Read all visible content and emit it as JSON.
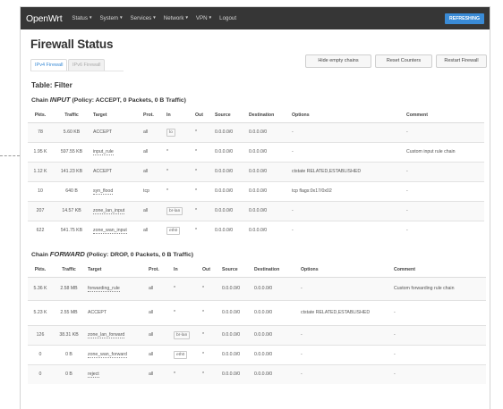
{
  "navbar": {
    "brand": "OpenWrt",
    "menus": [
      "Status",
      "System",
      "Services",
      "Network",
      "VPN"
    ],
    "logout": "Logout",
    "refresh_badge": "REFRESHING"
  },
  "page": {
    "title": "Firewall Status",
    "tabs": [
      {
        "label": "IPv4 Firewall",
        "active": true
      },
      {
        "label": "IPv6 Firewall",
        "active": false
      }
    ],
    "buttons": {
      "hide_empty": "Hide empty chains",
      "reset_counters": "Reset Counters",
      "restart_firewall": "Restart Firewall"
    },
    "table_title": "Table: Filter"
  },
  "input_chain": {
    "label": "Chain",
    "name": "INPUT",
    "policy_text": "(Policy: ACCEPT, 0 Packets, 0 B Traffic)",
    "headers": [
      "Pkts.",
      "Traffic",
      "Target",
      "Prot.",
      "In",
      "Out",
      "Source",
      "Destination",
      "Options",
      "Comment"
    ],
    "rows": [
      {
        "pkts": "78",
        "traffic": "5.60 KB",
        "target": "ACCEPT",
        "target_link": false,
        "prot": "all",
        "in": "lo",
        "in_box": true,
        "out": "*",
        "source": "0.0.0.0/0",
        "destination": "0.0.0.0/0",
        "options": "-",
        "comment": "-"
      },
      {
        "pkts": "1.95 K",
        "traffic": "597.55 KB",
        "target": "input_rule",
        "target_link": true,
        "prot": "all",
        "in": "*",
        "in_box": false,
        "out": "*",
        "source": "0.0.0.0/0",
        "destination": "0.0.0.0/0",
        "options": "-",
        "comment": "Custom input rule chain"
      },
      {
        "pkts": "1.12 K",
        "traffic": "141.23 KB",
        "target": "ACCEPT",
        "target_link": false,
        "prot": "all",
        "in": "*",
        "in_box": false,
        "out": "*",
        "source": "0.0.0.0/0",
        "destination": "0.0.0.0/0",
        "options": "ctstate RELATED,ESTABLISHED",
        "comment": "-"
      },
      {
        "pkts": "10",
        "traffic": "640 B",
        "target": "syn_flood",
        "target_link": true,
        "prot": "tcp",
        "in": "*",
        "in_box": false,
        "out": "*",
        "source": "0.0.0.0/0",
        "destination": "0.0.0.0/0",
        "options": "tcp flags:0x17/0x02",
        "comment": "-"
      },
      {
        "pkts": "207",
        "traffic": "14.57 KB",
        "target": "zone_lan_input",
        "target_link": true,
        "prot": "all",
        "in": "br-lan",
        "in_box": true,
        "out": "*",
        "source": "0.0.0.0/0",
        "destination": "0.0.0.0/0",
        "options": "-",
        "comment": "-"
      },
      {
        "pkts": "622",
        "traffic": "541.75 KB",
        "target": "zone_wan_input",
        "target_link": true,
        "prot": "all",
        "in": "eth0",
        "in_box": true,
        "out": "*",
        "source": "0.0.0.0/0",
        "destination": "0.0.0.0/0",
        "options": "-",
        "comment": "-"
      }
    ]
  },
  "forward_chain": {
    "label": "Chain",
    "name": "FORWARD",
    "policy_text": "(Policy: DROP, 0 Packets, 0 B Traffic)",
    "headers": [
      "Pkts.",
      "Traffic",
      "Target",
      "Prot.",
      "In",
      "Out",
      "Source",
      "Destination",
      "Options",
      "Comment"
    ],
    "rows": [
      {
        "pkts": "5.36 K",
        "traffic": "2.58 MB",
        "target": "forwarding_rule",
        "target_link": true,
        "prot": "all",
        "in": "*",
        "in_box": false,
        "out": "*",
        "source": "0.0.0.0/0",
        "destination": "0.0.0.0/0",
        "options": "-",
        "comment": "Custom forwarding rule chain"
      },
      {
        "pkts": "5.23 K",
        "traffic": "2.55 MB",
        "target": "ACCEPT",
        "target_link": false,
        "prot": "all",
        "in": "*",
        "in_box": false,
        "out": "*",
        "source": "0.0.0.0/0",
        "destination": "0.0.0.0/0",
        "options": "ctstate RELATED,ESTABLISHED",
        "comment": "-"
      },
      {
        "pkts": "126",
        "traffic": "38.31 KB",
        "target": "zone_lan_forward",
        "target_link": true,
        "prot": "all",
        "in": "br-lan",
        "in_box": true,
        "out": "*",
        "source": "0.0.0.0/0",
        "destination": "0.0.0.0/0",
        "options": "-",
        "comment": "-"
      },
      {
        "pkts": "0",
        "traffic": "0 B",
        "target": "zone_wan_forward",
        "target_link": true,
        "prot": "all",
        "in": "eth0",
        "in_box": true,
        "out": "*",
        "source": "0.0.0.0/0",
        "destination": "0.0.0.0/0",
        "options": "-",
        "comment": "-"
      },
      {
        "pkts": "0",
        "traffic": "0 B",
        "target": "reject",
        "target_link": true,
        "prot": "all",
        "in": "*",
        "in_box": false,
        "out": "*",
        "source": "0.0.0.0/0",
        "destination": "0.0.0.0/0",
        "options": "-",
        "comment": "-"
      }
    ]
  }
}
